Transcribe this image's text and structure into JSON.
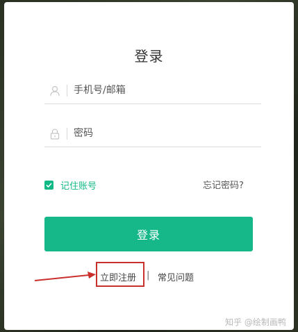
{
  "dialog": {
    "title": "登录"
  },
  "form": {
    "username_placeholder": "手机号/邮箱",
    "password_placeholder": "密码",
    "remember_label": "记住账号",
    "remember_checked": true,
    "forgot_label": "忘记密码?",
    "submit_label": "登录"
  },
  "footer": {
    "register_label": "立即注册",
    "separator": "|",
    "faq_label": "常见问题"
  },
  "annotation": {
    "highlight_color": "#c9302c"
  },
  "watermark": {
    "text": "知乎 @绘制画鸭"
  },
  "colors": {
    "accent": "#16b88a",
    "checkbox": "#12b886"
  },
  "icons": {
    "username": "user-icon",
    "password": "lock-icon",
    "checkbox": "check-icon"
  }
}
